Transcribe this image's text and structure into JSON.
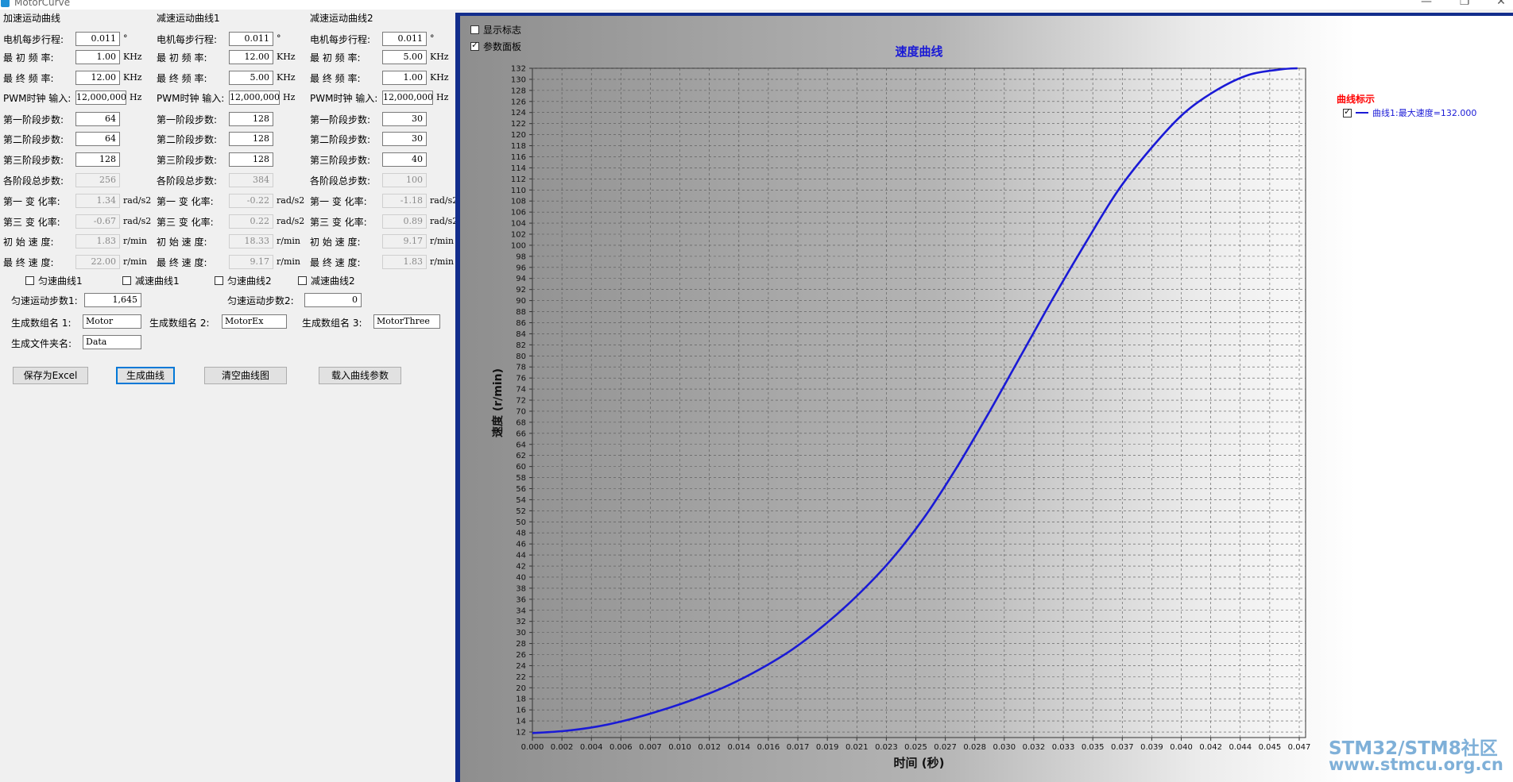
{
  "window": {
    "title": "MotorCurve"
  },
  "groups": [
    {
      "title": "加速运动曲线",
      "step_travel_label": "电机每步行程:",
      "step_travel_value": "0.011",
      "step_travel_unit": "°",
      "init_freq_label": "最 初  频 率:",
      "init_freq_value": "1.00",
      "init_freq_unit": "KHz",
      "final_freq_label": "最 终  频 率:",
      "final_freq_value": "12.00",
      "final_freq_unit": "KHz",
      "pwm_label": "PWM时钟 输入:",
      "pwm_value": "12,000,000",
      "pwm_unit": "Hz",
      "stage1_label": "第一阶段步数:",
      "stage1_value": "64",
      "stage2_label": "第二阶段步数:",
      "stage2_value": "64",
      "stage3_label": "第三阶段步数:",
      "stage3_value": "128",
      "total_label": "各阶段总步数:",
      "total_value": "256",
      "rate1_label": "第一 变 化率:",
      "rate1_value": "1.34",
      "rate1_unit": "rad/s2",
      "rate3_label": "第三 变 化率:",
      "rate3_value": "-0.67",
      "rate3_unit": "rad/s2",
      "init_speed_label": "初 始  速 度:",
      "init_speed_value": "1.83",
      "init_speed_unit": "r/min",
      "final_speed_label": "最 终  速 度:",
      "final_speed_value": "22.00",
      "final_speed_unit": "r/min"
    },
    {
      "title": "减速运动曲线1",
      "step_travel_label": "电机每步行程:",
      "step_travel_value": "0.011",
      "step_travel_unit": "°",
      "init_freq_label": "最 初  频 率:",
      "init_freq_value": "12.00",
      "init_freq_unit": "KHz",
      "final_freq_label": "最 终  频 率:",
      "final_freq_value": "5.00",
      "final_freq_unit": "KHz",
      "pwm_label": "PWM时钟 输入:",
      "pwm_value": "12,000,000",
      "pwm_unit": "Hz",
      "stage1_label": "第一阶段步数:",
      "stage1_value": "128",
      "stage2_label": "第二阶段步数:",
      "stage2_value": "128",
      "stage3_label": "第三阶段步数:",
      "stage3_value": "128",
      "total_label": "各阶段总步数:",
      "total_value": "384",
      "rate1_label": "第一 变 化率:",
      "rate1_value": "-0.22",
      "rate1_unit": "rad/s2",
      "rate3_label": "第三 变 化率:",
      "rate3_value": "0.22",
      "rate3_unit": "rad/s2",
      "init_speed_label": "初 始  速 度:",
      "init_speed_value": "18.33",
      "init_speed_unit": "r/min",
      "final_speed_label": "最 终  速 度:",
      "final_speed_value": "9.17",
      "final_speed_unit": "r/min"
    },
    {
      "title": "减速运动曲线2",
      "step_travel_label": "电机每步行程:",
      "step_travel_value": "0.011",
      "step_travel_unit": "°",
      "init_freq_label": "最 初  频 率:",
      "init_freq_value": "5.00",
      "init_freq_unit": "KHz",
      "final_freq_label": "最 终  频 率:",
      "final_freq_value": "1.00",
      "final_freq_unit": "KHz",
      "pwm_label": "PWM时钟 输入:",
      "pwm_value": "12,000,000",
      "pwm_unit": "Hz",
      "stage1_label": "第一阶段步数:",
      "stage1_value": "30",
      "stage2_label": "第二阶段步数:",
      "stage2_value": "30",
      "stage3_label": "第三阶段步数:",
      "stage3_value": "40",
      "total_label": "各阶段总步数:",
      "total_value": "100",
      "rate1_label": "第一 变 化率:",
      "rate1_value": "-1.18",
      "rate1_unit": "rad/s2",
      "rate3_label": "第三 变 化率:",
      "rate3_value": "0.89",
      "rate3_unit": "rad/s2",
      "init_speed_label": "初 始  速 度:",
      "init_speed_value": "9.17",
      "init_speed_unit": "r/min",
      "final_speed_label": "最 终  速 度:",
      "final_speed_value": "1.83",
      "final_speed_unit": "r/min"
    }
  ],
  "options": {
    "uniform1": "匀速曲线1",
    "decel1": "减速曲线1",
    "uniform2": "匀速曲线2",
    "decel2": "减速曲线2",
    "uniform_steps1_label": "匀速运动步数1:",
    "uniform_steps1_value": "1,645",
    "uniform_steps2_label": "匀速运动步数2:",
    "uniform_steps2_value": "0",
    "array1_label": "生成数组名 1:",
    "array1_value": "Motor",
    "array2_label": "生成数组名 2:",
    "array2_value": "MotorEx",
    "array3_label": "生成数组名 3:",
    "array3_value": "MotorThree",
    "folder_label": "生成文件夹名:",
    "folder_value": "Data"
  },
  "buttons": {
    "save_excel": "保存为Excel",
    "generate": "生成曲线",
    "clear": "清空曲线图",
    "load": "载入曲线参数"
  },
  "chart_panel": {
    "show_marks": "显示标志",
    "show_marks_checked": false,
    "param_panel": "参数面板",
    "param_panel_checked": true,
    "legend_title": "曲线标示",
    "legend_entry": "曲线1:最大速度=132.000",
    "legend_checked": true
  },
  "watermark": {
    "line1": "STM32/STM8社区",
    "line2": "www.stmcu.org.cn"
  },
  "colors": {
    "chart_border": "#122d8c",
    "curve": "#1a1ad6",
    "title": "#1a1ad6",
    "legend_title": "#ff0000"
  },
  "chart_data": {
    "type": "line",
    "title": "速度曲线",
    "xlabel": "时间 (秒)",
    "ylabel": "速度 (r/min)",
    "xlim": [
      0.0,
      0.0475
    ],
    "ylim": [
      11,
      132
    ],
    "x_tick_labels": [
      "0.000",
      "0.002",
      "0.004",
      "0.006",
      "0.007",
      "0.010",
      "0.012",
      "0.014",
      "0.016",
      "0.017",
      "0.019",
      "0.021",
      "0.023",
      "0.025",
      "0.027",
      "0.028",
      "0.030",
      "0.032",
      "0.033",
      "0.035",
      "0.037",
      "0.039",
      "0.040",
      "0.042",
      "0.044",
      "0.045",
      "0.047"
    ],
    "y_ticks": [
      12,
      14,
      16,
      18,
      20,
      22,
      24,
      26,
      28,
      30,
      32,
      34,
      36,
      38,
      40,
      42,
      44,
      46,
      48,
      50,
      52,
      54,
      56,
      58,
      60,
      62,
      64,
      66,
      68,
      70,
      72,
      74,
      76,
      78,
      80,
      82,
      84,
      86,
      88,
      90,
      92,
      94,
      96,
      98,
      100,
      102,
      104,
      106,
      108,
      110,
      112,
      114,
      116,
      118,
      120,
      122,
      124,
      126,
      128,
      130,
      132
    ],
    "grid": true,
    "legend": "right",
    "series": [
      {
        "name": "曲线1:最大速度=132.000",
        "x": [
          0.0,
          0.002,
          0.004,
          0.006,
          0.008,
          0.01,
          0.012,
          0.014,
          0.016,
          0.018,
          0.02,
          0.022,
          0.024,
          0.026,
          0.028,
          0.03,
          0.032,
          0.034,
          0.036,
          0.038,
          0.04,
          0.042,
          0.044,
          0.046,
          0.047
        ],
        "y": [
          11.8,
          12.2,
          13.0,
          14.3,
          16.0,
          18.0,
          20.4,
          23.4,
          27.0,
          31.5,
          36.8,
          43.0,
          50.5,
          59.5,
          69.5,
          80.0,
          90.5,
          100.5,
          110.0,
          117.5,
          123.8,
          128.0,
          130.8,
          131.8,
          132.0
        ]
      }
    ]
  }
}
